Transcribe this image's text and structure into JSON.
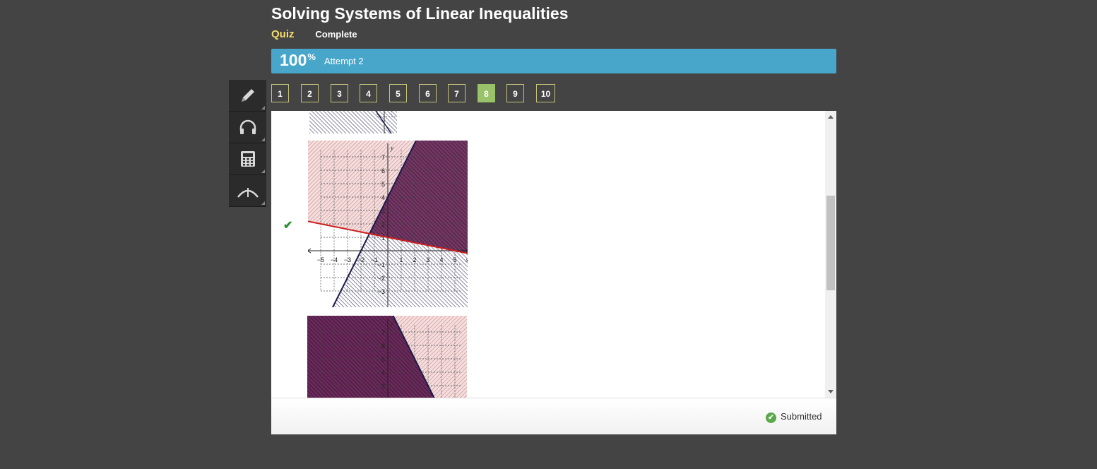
{
  "header": {
    "title": "Solving Systems of Linear Inequalities",
    "type_label": "Quiz",
    "status_label": "Complete"
  },
  "score": {
    "percent": "100",
    "percent_sign": "%",
    "attempt": "Attempt 2",
    "bar_color": "#48a6cb"
  },
  "tools": [
    {
      "name": "pencil-icon"
    },
    {
      "name": "headphones-icon"
    },
    {
      "name": "calculator-icon"
    },
    {
      "name": "angle-tool-icon"
    }
  ],
  "question_nav": {
    "buttons": [
      "1",
      "2",
      "3",
      "4",
      "5",
      "6",
      "7",
      "8",
      "9",
      "10"
    ],
    "active": "8",
    "active_color": "#9ac26a"
  },
  "graph": {
    "x_ticks": [
      "−5",
      "−4",
      "−3",
      "−2",
      "−1",
      "1",
      "2",
      "3",
      "4",
      "5"
    ],
    "y_ticks": [
      "7",
      "6",
      "5",
      "4",
      "3",
      "2",
      "1",
      "−1",
      "−2",
      "−3"
    ],
    "x_label": "x",
    "y_label": "y",
    "lines": [
      {
        "color": "#1a1a4a",
        "slope": 2,
        "intercept": 4
      },
      {
        "color": "#cc1f1f",
        "slope": -0.2,
        "intercept": 1
      }
    ]
  },
  "answer_check": "✔",
  "footer": {
    "submitted_icon": "✔",
    "submitted_label": "Submitted"
  }
}
